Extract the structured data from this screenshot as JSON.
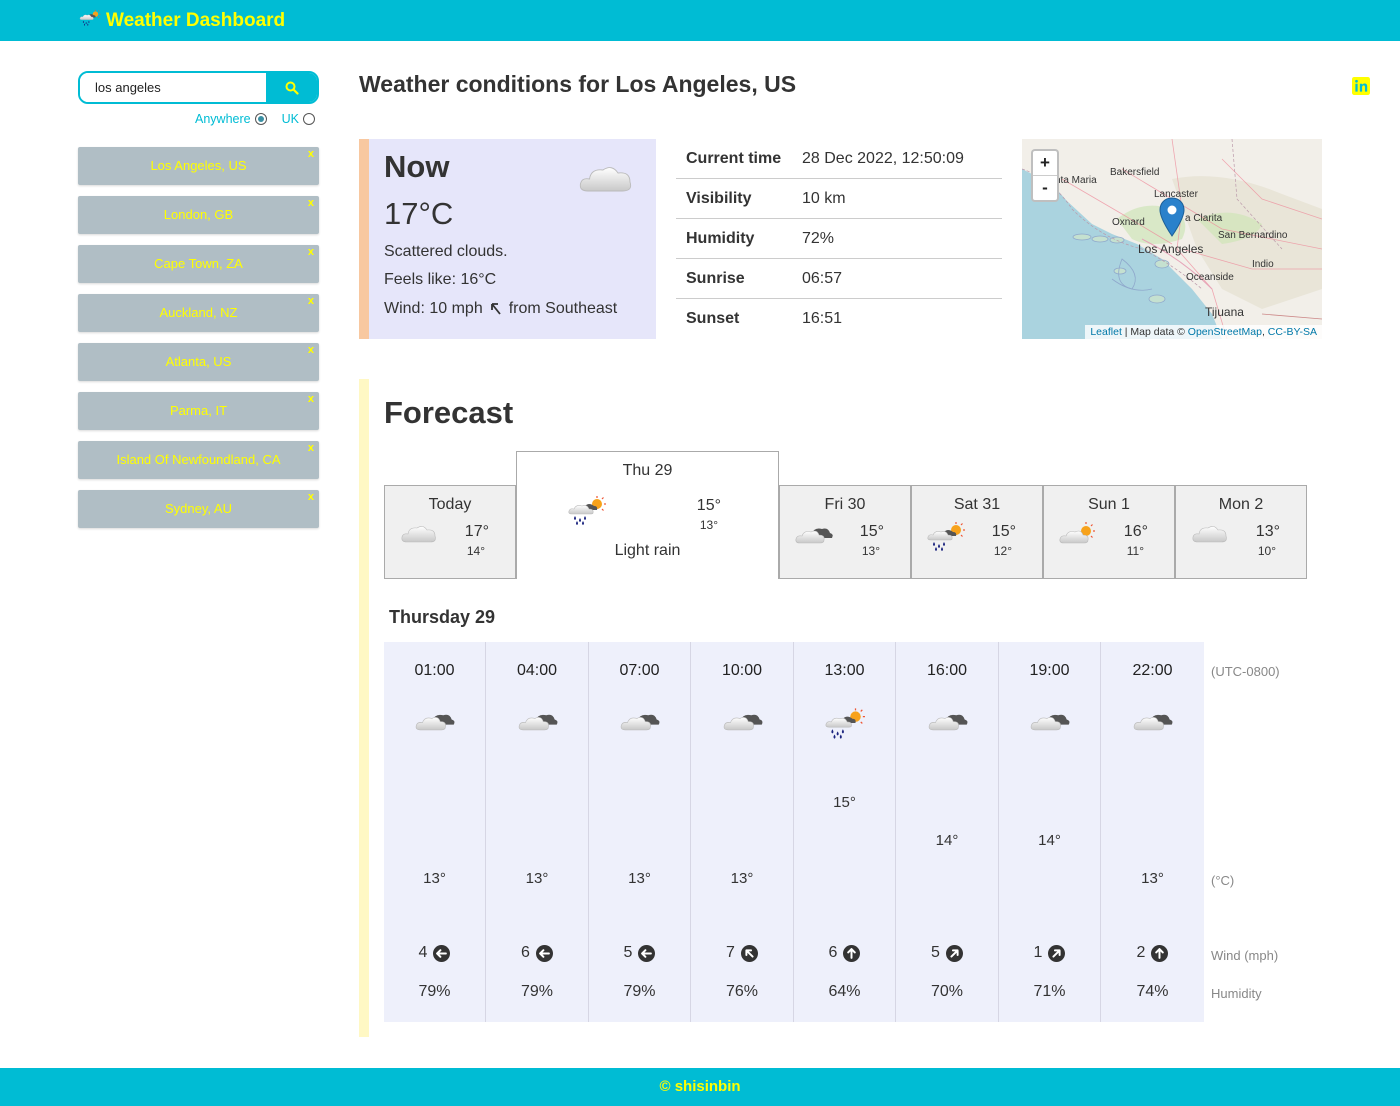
{
  "header": {
    "title": "Weather Dashboard",
    "icons": [
      "weather-logo-icon",
      "github-icon",
      "linkedin-icon"
    ]
  },
  "search": {
    "value": "los angeles",
    "placeholder": ""
  },
  "filter": {
    "option_anywhere": "Anywhere",
    "option_uk": "UK",
    "selected": "Anywhere"
  },
  "cities": [
    {
      "name": "Los Angeles, US",
      "remove": "x"
    },
    {
      "name": "London, GB",
      "remove": "x"
    },
    {
      "name": "Cape Town, ZA",
      "remove": "x"
    },
    {
      "name": "Auckland, NZ",
      "remove": "x"
    },
    {
      "name": "Atlanta, US",
      "remove": "x"
    },
    {
      "name": "Parma, IT",
      "remove": "x"
    },
    {
      "name": "Island Of Newfoundland, CA",
      "remove": "x"
    },
    {
      "name": "Sydney, AU",
      "remove": "x"
    }
  ],
  "main": {
    "title": "Weather conditions for Los Angeles, US"
  },
  "now": {
    "title": "Now",
    "temp": "17°C",
    "description": "Scattered clouds.",
    "feels_like": "Feels like: 16°C",
    "wind": "Wind: 10 mph",
    "wind_from": "from Southeast"
  },
  "details": [
    {
      "label": "Current time",
      "value": "28 Dec 2022, 12:50:09"
    },
    {
      "label": "Visibility",
      "value": "10 km"
    },
    {
      "label": "Humidity",
      "value": "72%"
    },
    {
      "label": "Sunrise",
      "value": "06:57"
    },
    {
      "label": "Sunset",
      "value": "16:51"
    }
  ],
  "map": {
    "zoom_in": "+",
    "zoom_out": "-",
    "attribution_leaflet": "Leaflet",
    "attribution_text": " | Map data © ",
    "attribution_osm": "OpenStreetMap",
    "attribution_sep": ", ",
    "attribution_license": "CC-BY-SA",
    "labels": {
      "santa_maria": "nta Maria",
      "bakersfield": "Bakersfield",
      "lancaster": "Lancaster",
      "santa_clarita": "a Clarita",
      "oxnard": "Oxnard",
      "san_bernardino": "San Bernardino",
      "los_angeles": "Los Angeles",
      "indio": "Indio",
      "oceanside": "Oceanside",
      "tijuana": "Tijuana"
    }
  },
  "forecast": {
    "title": "Forecast",
    "days": [
      {
        "name": "Today",
        "hi": "17°",
        "lo": "14°",
        "icon": "cloud-icon"
      },
      {
        "name": "Thu 29",
        "hi": "15°",
        "lo": "13°",
        "icon": "light-rain-icon",
        "description": "Light rain"
      },
      {
        "name": "Fri 30",
        "hi": "15°",
        "lo": "13°",
        "icon": "broken-clouds-icon"
      },
      {
        "name": "Sat 31",
        "hi": "15°",
        "lo": "12°",
        "icon": "light-rain-icon"
      },
      {
        "name": "Sun 1",
        "hi": "16°",
        "lo": "11°",
        "icon": "partly-sunny-icon"
      },
      {
        "name": "Mon 2",
        "hi": "13°",
        "lo": "10°",
        "icon": "cloud-icon"
      }
    ],
    "selected_day_title": "Thursday 29",
    "hourly": [
      {
        "time": "01:00",
        "temp": "13°",
        "temp_c": 13,
        "wind": "4",
        "wind_dir_deg": 270,
        "humidity": "79%",
        "icon": "broken-clouds-icon"
      },
      {
        "time": "04:00",
        "temp": "13°",
        "temp_c": 13,
        "wind": "6",
        "wind_dir_deg": 270,
        "humidity": "79%",
        "icon": "broken-clouds-icon"
      },
      {
        "time": "07:00",
        "temp": "13°",
        "temp_c": 13,
        "wind": "5",
        "wind_dir_deg": 270,
        "humidity": "79%",
        "icon": "broken-clouds-icon"
      },
      {
        "time": "10:00",
        "temp": "13°",
        "temp_c": 13,
        "wind": "7",
        "wind_dir_deg": 315,
        "humidity": "76%",
        "icon": "broken-clouds-icon"
      },
      {
        "time": "13:00",
        "temp": "15°",
        "temp_c": 15,
        "wind": "6",
        "wind_dir_deg": 0,
        "humidity": "64%",
        "icon": "light-rain-icon"
      },
      {
        "time": "16:00",
        "temp": "14°",
        "temp_c": 14,
        "wind": "5",
        "wind_dir_deg": 45,
        "humidity": "70%",
        "icon": "broken-clouds-icon"
      },
      {
        "time": "19:00",
        "temp": "14°",
        "temp_c": 14,
        "wind": "1",
        "wind_dir_deg": 45,
        "humidity": "71%",
        "icon": "broken-clouds-icon"
      },
      {
        "time": "22:00",
        "temp": "13°",
        "temp_c": 13,
        "wind": "2",
        "wind_dir_deg": 0,
        "humidity": "74%",
        "icon": "broken-clouds-icon"
      }
    ],
    "units": {
      "time": "(UTC-0800)",
      "temp": "(°C)",
      "wind": "Wind (mph)",
      "humidity": "Humidity"
    }
  },
  "footer": {
    "text": "© shisinbin"
  },
  "colors": {
    "primary": "#00bcd4",
    "accent": "#ffff00",
    "city_bg": "#b0bec5",
    "now_bg": "#e6e6fa",
    "hourly_bg": "#eef0fb"
  }
}
